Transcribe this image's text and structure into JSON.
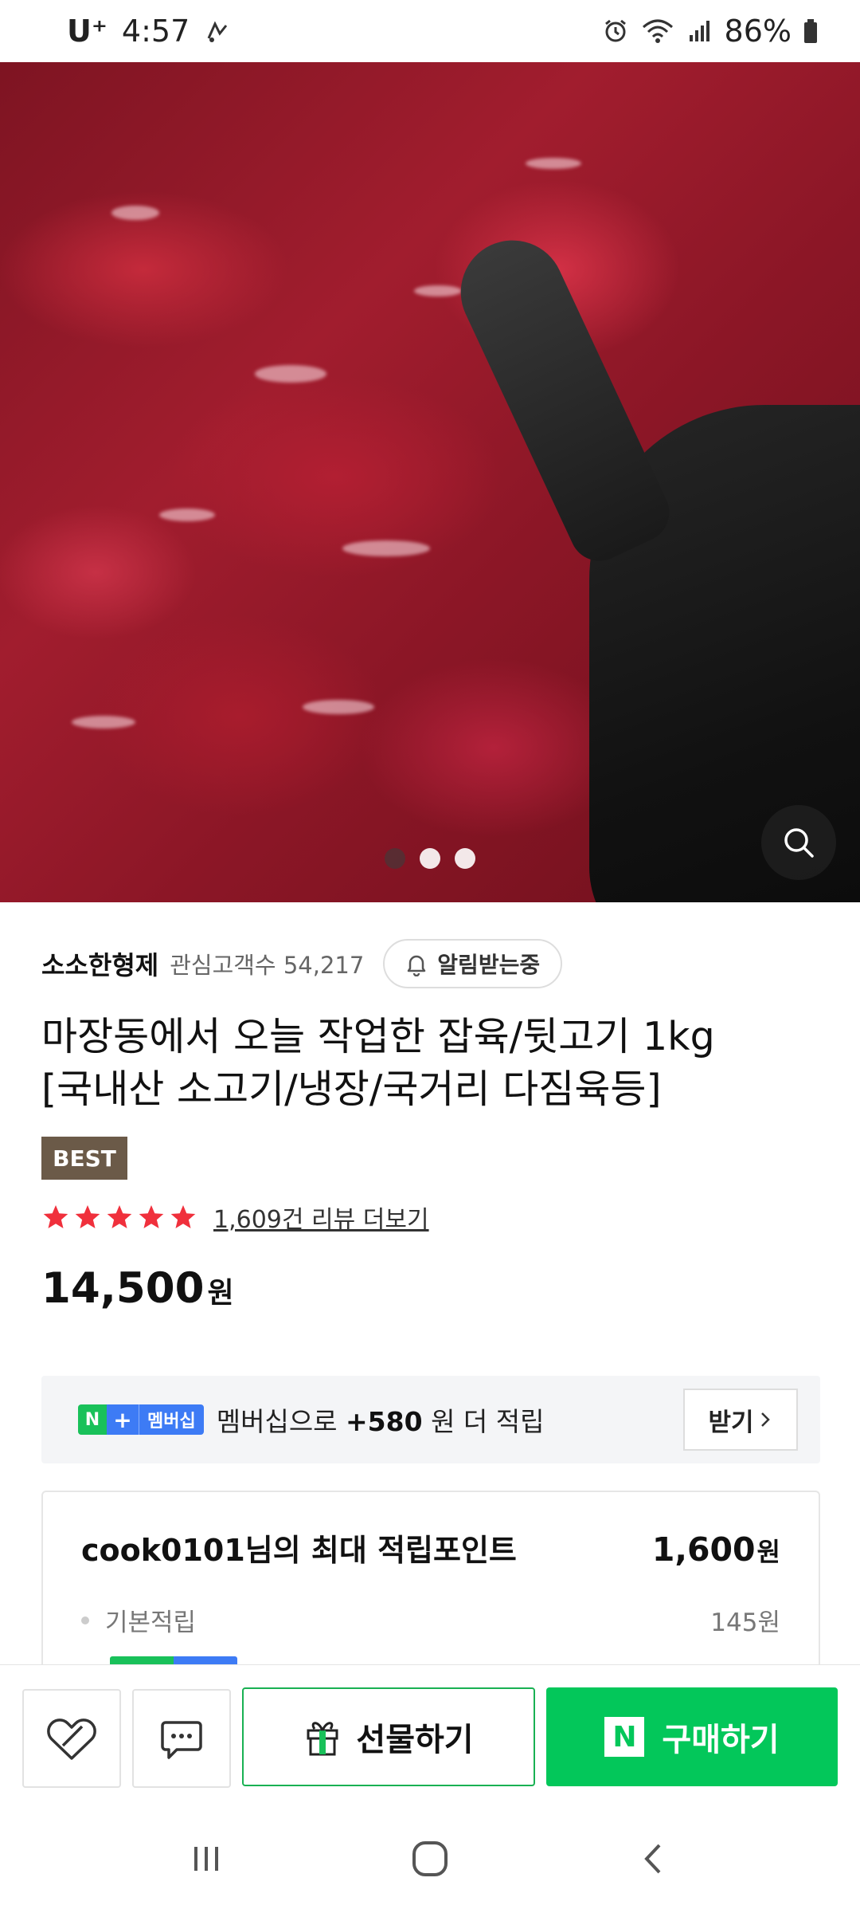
{
  "status_bar": {
    "carrier": "U⁺",
    "time": "4:57",
    "battery": "86%"
  },
  "gallery": {
    "dot_count": 3,
    "active_index": 0
  },
  "store": {
    "name": "소소한형제",
    "followers_label": "관심고객수 54,217",
    "notify_label": "알림받는중"
  },
  "product": {
    "title_line1": "마장동에서 오늘 작업한 잡육/뒷고기 1kg",
    "title_line2": "[국내산 소고기/냉장/국거리 다짐육등]",
    "badge": "BEST",
    "rating_stars": 5,
    "review_link": "1,609건 리뷰 더보기",
    "price": "14,500",
    "price_unit": "원"
  },
  "membership": {
    "badge_n": "N",
    "badge_plus": "+",
    "badge_label": "멤버십",
    "text_prefix": "멤버십으로 ",
    "text_amount": "+580",
    "text_suffix": " 원 더 적립",
    "receive_label": "받기"
  },
  "points": {
    "title": "cook0101님의 최대 적립포인트",
    "total": "1,600",
    "total_unit": "원",
    "rows": [
      {
        "label": "기본적립",
        "value": "145원"
      }
    ]
  },
  "actions": {
    "gift_label": "선물하기",
    "buy_label": "구매하기",
    "buy_logo": "N"
  },
  "colors": {
    "naver_green": "#03c75a",
    "star_red": "#f0303c",
    "best_badge": "#6b5a48"
  }
}
